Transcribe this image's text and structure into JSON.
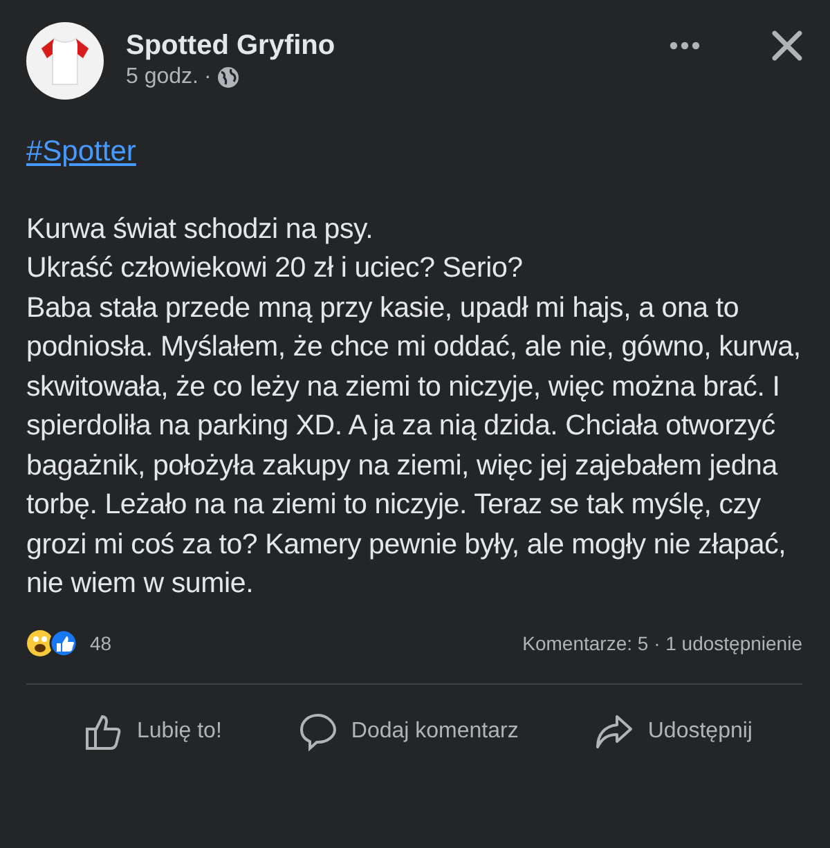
{
  "post": {
    "author": "Spotted Gryfino",
    "time": "5 godz.",
    "separator": "·",
    "hashtag": "#Spotter",
    "paragraphs": [
      "Kurwa świat schodzi na psy.",
      "Ukraść człowiekowi 20 zł i uciec? Serio?",
      "Baba stała przede mną przy kasie, upadł mi hajs, a ona to podniosła. Myślałem, że chce mi oddać, ale nie, gówno, kurwa, skwitowała, że co leży na ziemi to niczyje, więc można brać. I spierdoliła na parking XD. A ja za nią dzida. Chciała otworzyć bagażnik, położyła zakupy na ziemi, więc jej zajebałem jedna torbę. Leżało na na ziemi to niczyje. Teraz se tak myślę, czy grozi mi coś za to? Kamery pewnie były, ale mogły nie złapać, nie wiem w sumie."
    ],
    "reaction_count": "48",
    "stats": "Komentarze: 5 · 1 udostępnienie",
    "actions": [
      {
        "kind": "like",
        "label": "Lubię to!"
      },
      {
        "kind": "comment",
        "label": "Dodaj komentarz"
      },
      {
        "kind": "share",
        "label": "Udostępnij"
      }
    ]
  }
}
